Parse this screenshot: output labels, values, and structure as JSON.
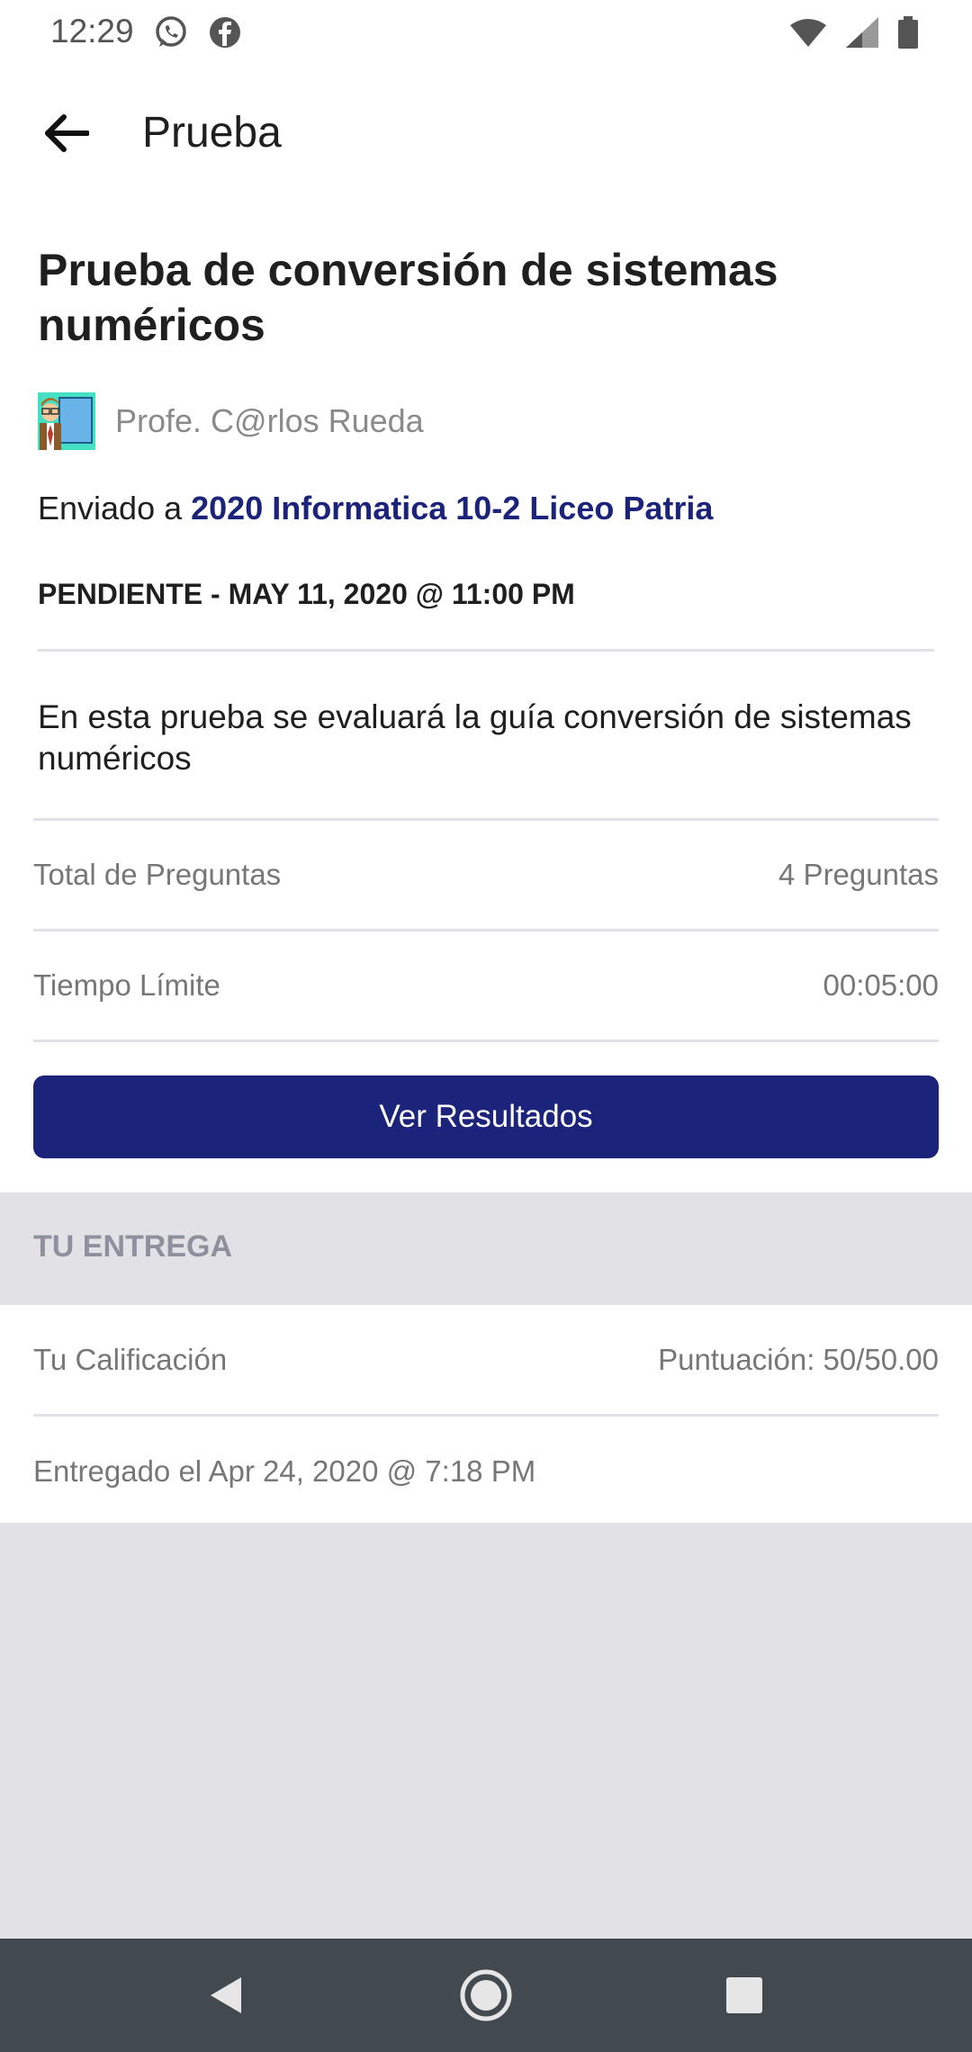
{
  "status_bar": {
    "time": "12:29"
  },
  "app_bar": {
    "title": "Prueba"
  },
  "quiz": {
    "title": "Prueba de conversión de sistemas numéricos",
    "teacher": "Profe. C@rlos Rueda",
    "sent_to_prefix": "Enviado a ",
    "sent_to_class": "2020 Informatica 10-2 Liceo Patria",
    "due": "PENDIENTE - MAY 11, 2020 @ 11:00 PM",
    "description": "En esta prueba se evaluará la guía conversión de sistemas numéricos"
  },
  "details": {
    "total_label": "Total de Preguntas",
    "total_value": "4 Preguntas",
    "time_label": "Tiempo Límite",
    "time_value": "00:05:00"
  },
  "actions": {
    "results_label": "Ver Resultados"
  },
  "submission": {
    "header": "TU ENTREGA",
    "grade_label": "Tu Calificación",
    "grade_value": "Puntuación: 50/50.00",
    "submitted_text": "Entregado el Apr 24, 2020 @ 7:18 PM"
  },
  "colors": {
    "primary": "#1b237a",
    "gray_bg": "#e2e2e6",
    "nav_bg": "#434a4f"
  },
  "icons": {
    "back": "arrow-left-icon",
    "whatsapp": "whatsapp-icon",
    "facebook": "facebook-icon",
    "wifi": "wifi-icon",
    "signal": "signal-icon",
    "battery": "battery-icon",
    "nav_back": "nav-back-icon",
    "nav_home": "nav-home-icon",
    "nav_recents": "nav-recents-icon"
  }
}
